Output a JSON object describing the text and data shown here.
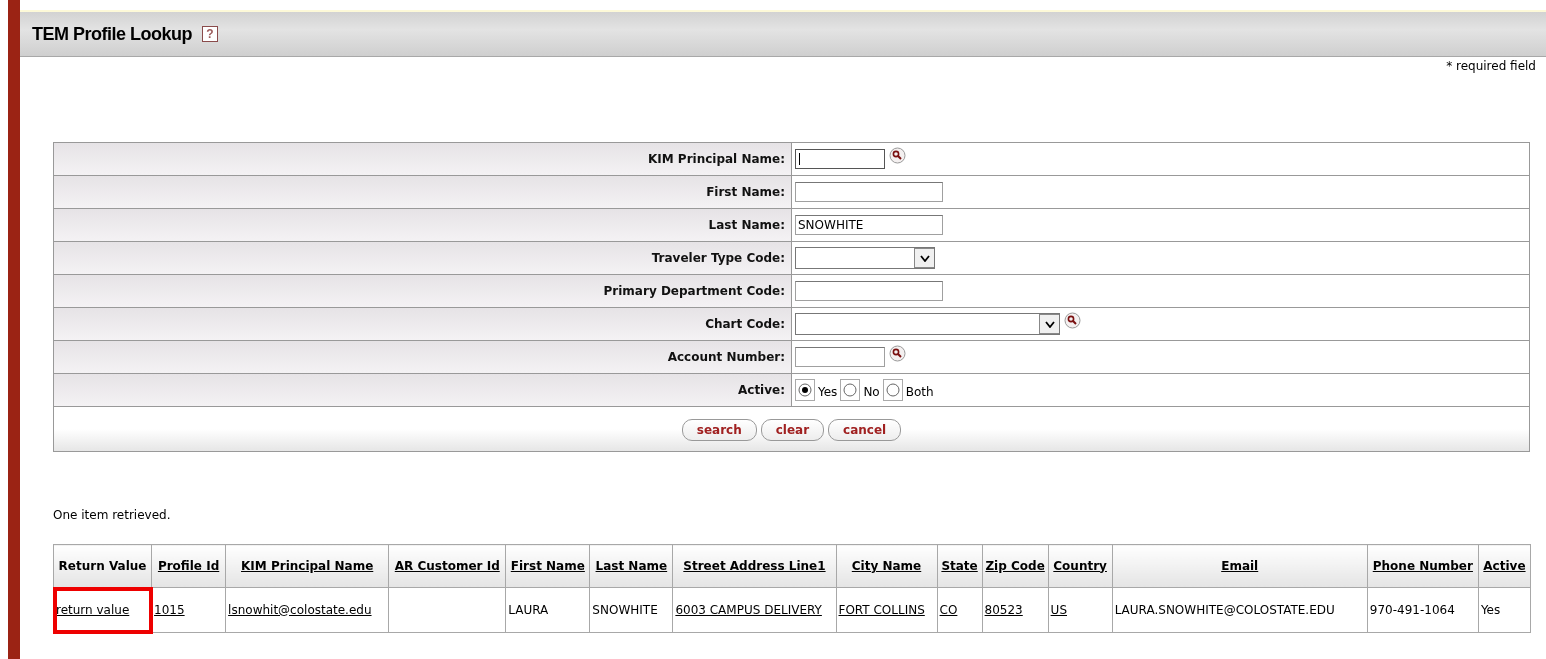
{
  "header": {
    "title": "TEM Profile Lookup",
    "help": "?"
  },
  "required_note": "* required field",
  "form": {
    "fields": [
      {
        "label": "KIM Principal Name:",
        "kind": "text",
        "lookup": true,
        "focused": true
      },
      {
        "label": "First Name:",
        "kind": "text",
        "lookup": false
      },
      {
        "label": "Last Name:",
        "kind": "text",
        "value": "SNOWHITE",
        "lookup": false
      },
      {
        "label": "Traveler Type Code:",
        "kind": "select",
        "lookup": false
      },
      {
        "label": "Primary Department Code:",
        "kind": "text",
        "lookup": false
      },
      {
        "label": "Chart Code:",
        "kind": "select",
        "lookup": true
      },
      {
        "label": "Account Number:",
        "kind": "text",
        "lookup": true
      },
      {
        "label": "Active:",
        "kind": "radio",
        "options": [
          {
            "label": "Yes",
            "selected": true
          },
          {
            "label": "No",
            "selected": false
          },
          {
            "label": "Both",
            "selected": false
          }
        ]
      }
    ],
    "buttons": [
      "search",
      "clear",
      "cancel"
    ]
  },
  "result_message": "One item retrieved.",
  "table": {
    "columns": [
      {
        "label": "Return Value",
        "sortable": false
      },
      {
        "label": "Profile Id",
        "sortable": true
      },
      {
        "label": "KIM Principal Name",
        "sortable": true
      },
      {
        "label": "AR Customer Id",
        "sortable": true
      },
      {
        "label": "First Name",
        "sortable": true
      },
      {
        "label": "Last Name",
        "sortable": true
      },
      {
        "label": "Street Address Line1",
        "sortable": true
      },
      {
        "label": "City Name",
        "sortable": true
      },
      {
        "label": "State",
        "sortable": true
      },
      {
        "label": "Zip Code",
        "sortable": true
      },
      {
        "label": "Country",
        "sortable": true
      },
      {
        "label": "Email",
        "sortable": true
      },
      {
        "label": "Phone Number",
        "sortable": true
      },
      {
        "label": "Active",
        "sortable": true
      }
    ],
    "rows": [
      {
        "cells": [
          {
            "text": "return value",
            "link": true,
            "highlighted": true
          },
          {
            "text": "1015",
            "link": true,
            "highlighted": false
          },
          {
            "text": "lsnowhit@colostate.edu",
            "link": true,
            "highlighted": false
          },
          {
            "highlighted": false
          },
          {
            "text": "LAURA",
            "link": false,
            "highlighted": false
          },
          {
            "text": "SNOWHITE",
            "link": false,
            "highlighted": false
          },
          {
            "text": "6003 CAMPUS DELIVERY",
            "link": true,
            "highlighted": false
          },
          {
            "text": "FORT COLLINS",
            "link": true,
            "highlighted": false
          },
          {
            "text": "CO",
            "link": true,
            "highlighted": false
          },
          {
            "text": "80523",
            "link": true,
            "highlighted": false
          },
          {
            "text": "US",
            "link": true,
            "highlighted": false
          },
          {
            "text": "LAURA.SNOWHITE@COLOSTATE.EDU",
            "link": false,
            "highlighted": false
          },
          {
            "text": "970-491-1064",
            "link": false,
            "highlighted": false
          },
          {
            "text": "Yes",
            "link": false,
            "highlighted": false
          }
        ]
      }
    ]
  }
}
